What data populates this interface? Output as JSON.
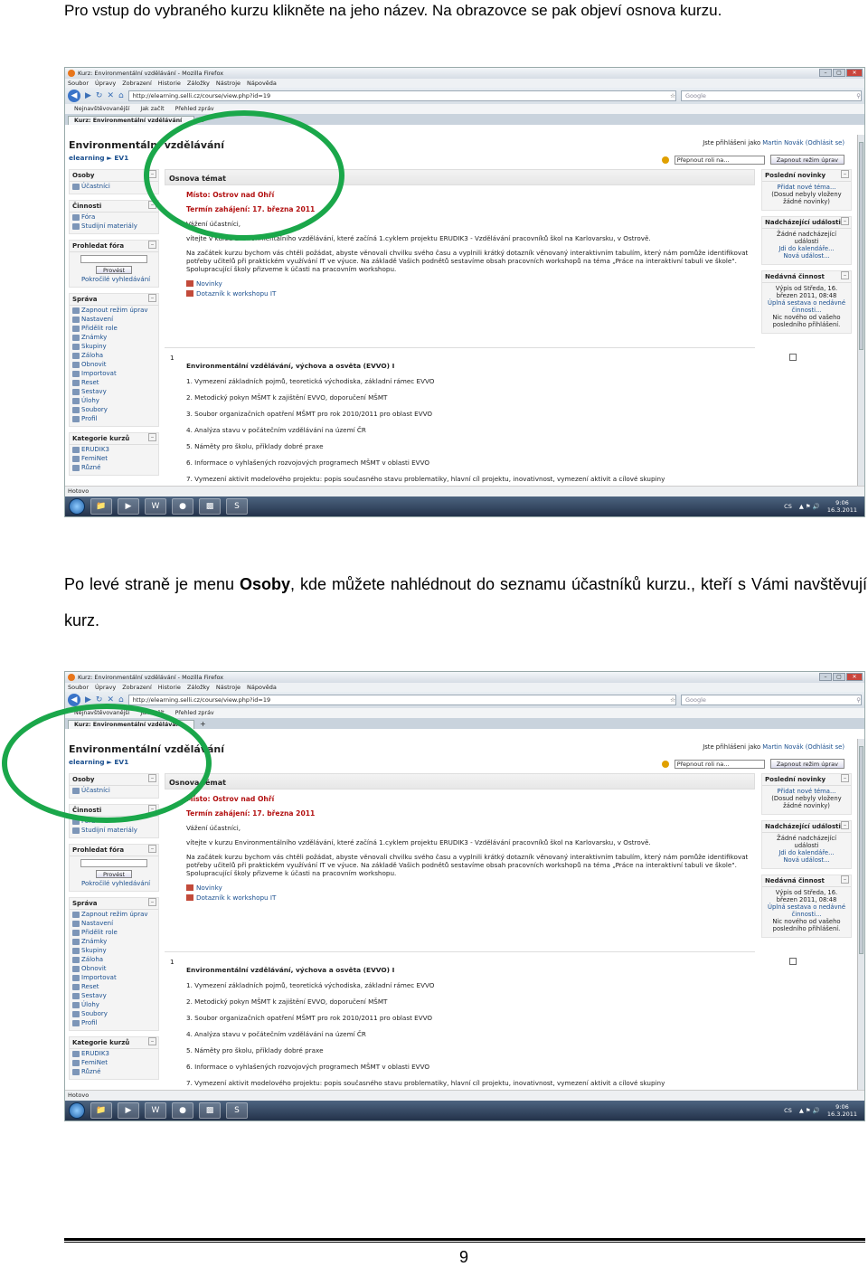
{
  "doc": {
    "p1": "Pro vstup do vybraného kurzu klikněte na jeho název. Na obrazovce se pak objeví osnova kurzu.",
    "p2_pre": "Po levé straně je menu ",
    "p2_bold": "Osoby",
    "p2_post": ", kde můžete nahlédnout do seznamu účastníků kurzu., kteří s Vámi navštěvují kurz.",
    "page_number": "9"
  },
  "browser": {
    "window_title": "Kurz: Environmentální vzdělávání - Mozilla Firefox",
    "window_controls": [
      "–",
      "▢",
      "✕"
    ],
    "menu": [
      "Soubor",
      "Úpravy",
      "Zobrazení",
      "Historie",
      "Záložky",
      "Nástroje",
      "Nápověda"
    ],
    "url": "http://elearning.selli.cz/course/view.php?id=19",
    "search_placeholder": "Google",
    "bookmarks": [
      "Nejnavštěvovanější",
      "Jak začít",
      "Přehled zpráv"
    ],
    "tab": "Kurz: Environmentální vzdělávání",
    "status": "Hotovo"
  },
  "course": {
    "title": "Environmentální vzdělávání",
    "breadcrumb": "elearning ► EV1",
    "logged_in_prefix": "Jste přihlášeni jako ",
    "logged_in_user": "Martin Novák",
    "logout": "(Odhlásit se)",
    "switch_role": "Přepnout roli na...",
    "edit_button": "Zapnout režim úprav"
  },
  "left_blocks": {
    "people": {
      "title": "Osoby",
      "items": [
        "Účastníci"
      ]
    },
    "activities": {
      "title": "Činnosti",
      "items": [
        "Fóra",
        "Studijní materiály"
      ]
    },
    "search": {
      "title": "Prohledat fóra",
      "button": "Provést",
      "advanced": "Pokročilé vyhledávání"
    },
    "admin": {
      "title": "Správa",
      "items": [
        "Zapnout režim úprav",
        "Nastavení",
        "Přidělit role",
        "Známky",
        "Skupiny",
        "Záloha",
        "Obnovit",
        "Importovat",
        "Reset",
        "Sestavy",
        "Úlohy",
        "Soubory",
        "Profil"
      ]
    },
    "categories": {
      "title": "Kategorie kurzů",
      "items": [
        "ERUDIK3",
        "FemiNet",
        "Různé"
      ]
    }
  },
  "center": {
    "section_title": "Osnova témat",
    "place": "Místo: Ostrov nad Ohří",
    "start_date": "Termín zahájení: 17. března 2011",
    "greeting": "Vážení účastníci,",
    "welcome": "vítejte v kurzu Environmentálního vzdělávání, které začíná 1.cyklem projektu ERUDIK3 - Vzdělávání pracovníků škol na Karlovarsku, v Ostrově.",
    "intro": "Na začátek kurzu bychom vás chtěli požádat, abyste věnovali chvilku svého času a vyplnili krátký dotazník věnovaný interaktivním tabulím, který nám pomůže identifikovat potřeby učitelů při praktickém využívání IT ve výuce. Na základě Vašich podnětů sestavíme obsah pracovních workshopů na téma „Práce na interaktivní tabuli ve škole\". Spolupracující školy přizveme k účasti na pracovním workshopu.",
    "links": [
      "Novinky",
      "Dotazník k workshopu IT"
    ],
    "section1_number": "1",
    "section1_title": "Environmentální vzdělávání, výchova a osvěta (EVVO) I",
    "section1_items": [
      "1. Vymezení základních pojmů, teoretická východiska, základní rámec EVVO",
      "2. Metodický pokyn MŠMT k zajištění EVVO, doporučení MŠMT",
      "3. Soubor organizačních opatření MŠMT pro rok 2010/2011 pro oblast EVVO",
      "4. Analýza stavu v počátečním vzdělávání na území ČR",
      "5. Náměty pro školu, příklady dobré praxe",
      "6. Informace o vyhlašených rozvojových programech MŠMT v oblasti EVVO",
      "7. Vymezení aktivit modelového projektu: popis současného stavu problematiky, hlavní cíl projektu, inovativnost, vymezení aktivit a cílové skupiny"
    ]
  },
  "right_blocks": {
    "news": {
      "title": "Poslední novinky",
      "add": "Přidat nové téma...",
      "empty": "(Dosud nebyly vloženy žádné novinky)"
    },
    "events": {
      "title": "Nadcházející události",
      "empty": "Žádné nadcházející události",
      "calendar": "Jdi do kalendáře...",
      "new_event": "Nová událost..."
    },
    "recent": {
      "title": "Nedávná činnost",
      "since": "Výpis od Středa, 16. březen 2011, 08:48",
      "full": "Úplná sestava o nedávné činnosti...",
      "nothing": "Nic nového od vašeho posledního přihlášení."
    }
  },
  "taskbar": {
    "lang": "CS",
    "time": "9:06",
    "date": "16.3.2011"
  },
  "colors": {
    "highlight_ring": "#1aa74a",
    "link": "#1a4f8f",
    "accent_red": "#b21010"
  }
}
